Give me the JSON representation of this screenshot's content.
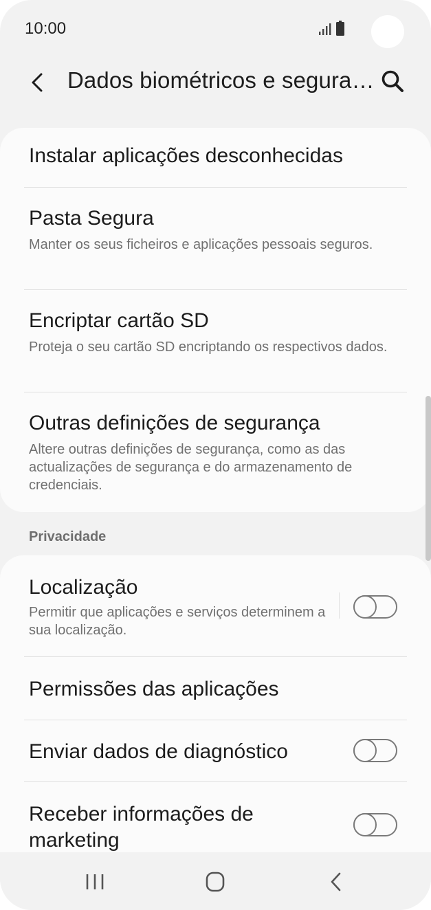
{
  "status_bar": {
    "time": "10:00",
    "icons": [
      "signal-icon",
      "battery-icon"
    ]
  },
  "header": {
    "title": "Dados biométricos e segura…",
    "back_icon": "chevron-left-icon",
    "search_icon": "search-icon"
  },
  "security_items": [
    {
      "title": "Instalar aplicações desconhecidas",
      "description": ""
    },
    {
      "title": "Pasta Segura",
      "description": "Manter os seus ficheiros e aplicações pessoais seguros."
    },
    {
      "title": "Encriptar cartão SD",
      "description": "Proteja o seu cartão SD encriptando os respectivos dados."
    },
    {
      "title": "Outras definições de segurança",
      "description": "Altere outras definições de segurança, como as das actualizações de segurança e do armazenamento de credenciais."
    }
  ],
  "privacy": {
    "section_label": "Privacidade",
    "items": [
      {
        "title": "Localização",
        "description": "Permitir que aplicações e serviços determinem a sua localização.",
        "toggle_on": false
      },
      {
        "title": "Permissões das aplicações",
        "description": ""
      },
      {
        "title": "Enviar dados de diagnóstico",
        "description": "",
        "toggle_on": false
      },
      {
        "title": "Receber informações de marketing",
        "description": "",
        "toggle_on": false
      }
    ]
  },
  "nav_bar": {
    "icons": [
      "recents-icon",
      "home-icon",
      "back-icon"
    ]
  },
  "colors": {
    "background": "#f2f2f2",
    "card": "#fbfbfb",
    "title_text": "#1c1c1c",
    "secondary_text": "#707070",
    "toggle_off": "#7a7a7a"
  }
}
